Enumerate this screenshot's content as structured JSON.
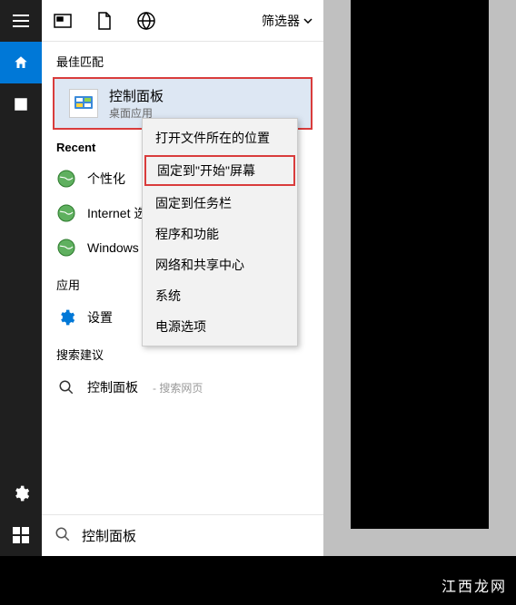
{
  "toolbar": {
    "filter_label": "筛选器"
  },
  "sections": {
    "best_match": "最佳匹配",
    "recent": "Recent",
    "apps": "应用",
    "suggestions": "搜索建议"
  },
  "best_match_item": {
    "title": "控制面板",
    "subtitle": "桌面应用"
  },
  "recent_items": [
    {
      "label": "个性化"
    },
    {
      "label": "Internet 选"
    },
    {
      "label": "Windows "
    }
  ],
  "app_items": [
    {
      "label": "设置"
    }
  ],
  "suggestions": [
    {
      "label": "控制面板",
      "sub": "- 搜索网页"
    }
  ],
  "context_menu": [
    "打开文件所在的位置",
    "固定到\"开始\"屏幕",
    "固定到任务栏",
    "程序和功能",
    "网络和共享中心",
    "系统",
    "电源选项"
  ],
  "search": {
    "value": "控制面板"
  },
  "watermark": "江西龙网"
}
